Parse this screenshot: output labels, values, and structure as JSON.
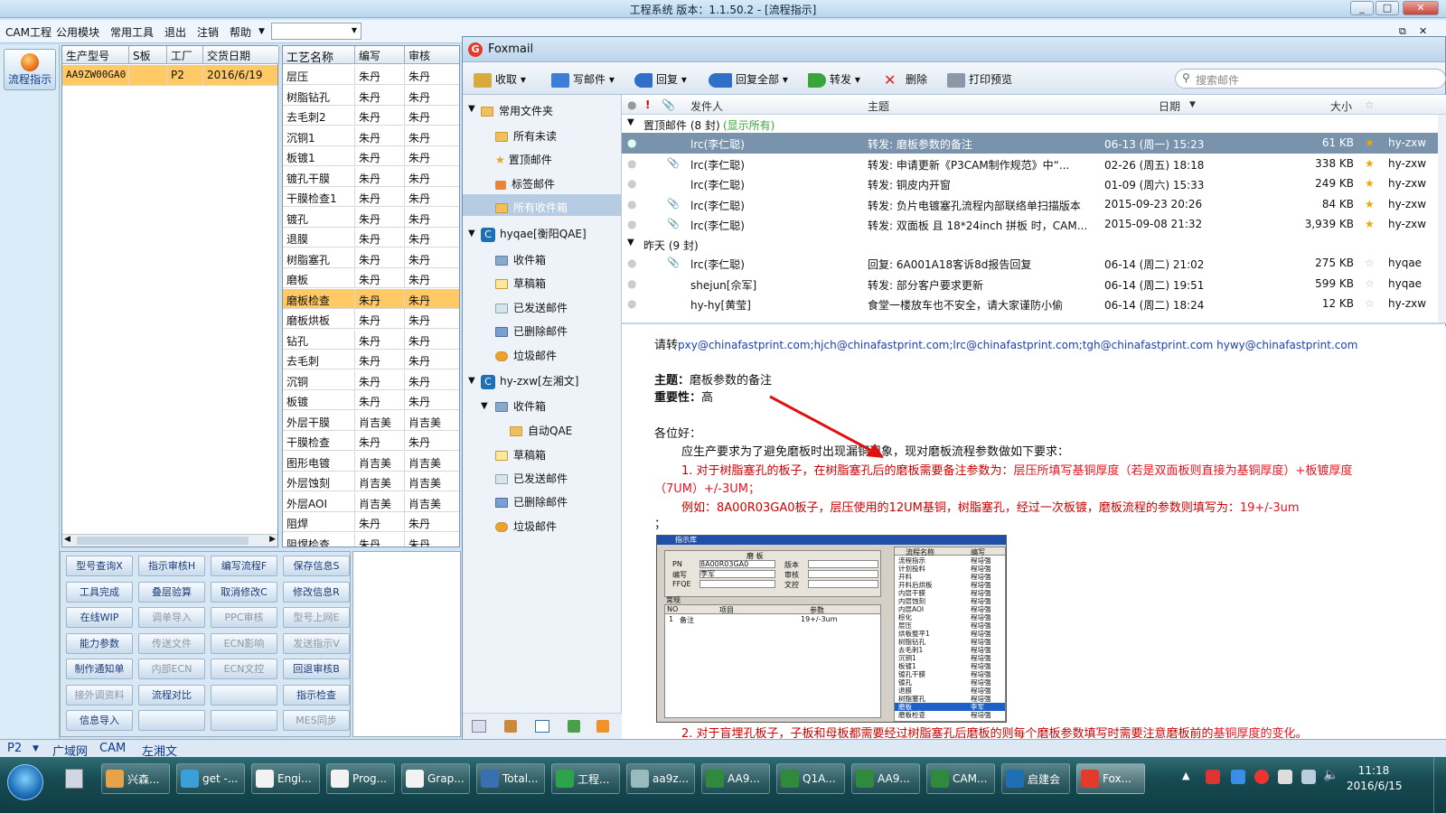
{
  "window": {
    "title": "工程系统   版本：1.1.50.2 - [流程指示]"
  },
  "menu": {
    "items": [
      "CAM工程",
      "公用模块",
      "常用工具",
      "退出",
      "注销",
      "帮助"
    ],
    "dropdown_value": ""
  },
  "left": {
    "flow_label": "流程指示"
  },
  "left_grid": {
    "headers": [
      "生产型号",
      "S板",
      "工厂",
      "交货日期"
    ],
    "rows": [
      [
        "AA9ZW00GA0",
        "",
        "P2",
        "2016/6/19"
      ]
    ]
  },
  "process_grid": {
    "headers": [
      "工艺名称",
      "编写",
      "审核"
    ],
    "selected_index": 11,
    "rows": [
      [
        "层压",
        "朱丹",
        "朱丹"
      ],
      [
        "树脂钻孔",
        "朱丹",
        "朱丹"
      ],
      [
        "去毛刺2",
        "朱丹",
        "朱丹"
      ],
      [
        "沉铜1",
        "朱丹",
        "朱丹"
      ],
      [
        "板镀1",
        "朱丹",
        "朱丹"
      ],
      [
        "镀孔干膜",
        "朱丹",
        "朱丹"
      ],
      [
        "干膜检查1",
        "朱丹",
        "朱丹"
      ],
      [
        "镀孔",
        "朱丹",
        "朱丹"
      ],
      [
        "退膜",
        "朱丹",
        "朱丹"
      ],
      [
        "树脂塞孔",
        "朱丹",
        "朱丹"
      ],
      [
        "磨板",
        "朱丹",
        "朱丹"
      ],
      [
        "磨板检查",
        "朱丹",
        "朱丹"
      ],
      [
        "磨板烘板",
        "朱丹",
        "朱丹"
      ],
      [
        "钻孔",
        "朱丹",
        "朱丹"
      ],
      [
        "去毛刺",
        "朱丹",
        "朱丹"
      ],
      [
        "沉铜",
        "朱丹",
        "朱丹"
      ],
      [
        "板镀",
        "朱丹",
        "朱丹"
      ],
      [
        "外层干膜",
        "肖吉美",
        "肖吉美"
      ],
      [
        "干膜检查",
        "朱丹",
        "朱丹"
      ],
      [
        "图形电镀",
        "肖吉美",
        "肖吉美"
      ],
      [
        "外层蚀刻",
        "肖吉美",
        "肖吉美"
      ],
      [
        "外层AOI",
        "肖吉美",
        "肖吉美"
      ],
      [
        "阻焊",
        "朱丹",
        "朱丹"
      ],
      [
        "阻焊检查",
        "朱丹",
        "朱丹"
      ]
    ]
  },
  "func_buttons": [
    {
      "label": "型号查询X",
      "enabled": true
    },
    {
      "label": "指示审核H",
      "enabled": true
    },
    {
      "label": "编写流程F",
      "enabled": true
    },
    {
      "label": "保存信息S",
      "enabled": true
    },
    {
      "label": "工具完成",
      "enabled": true
    },
    {
      "label": "叠层验算",
      "enabled": true
    },
    {
      "label": "取消修改C",
      "enabled": true
    },
    {
      "label": "修改信息R",
      "enabled": true
    },
    {
      "label": "在线WIP",
      "enabled": true
    },
    {
      "label": "调单导入",
      "enabled": false
    },
    {
      "label": "PPC审核",
      "enabled": false
    },
    {
      "label": "型号上网E",
      "enabled": false
    },
    {
      "label": "能力参数",
      "enabled": true
    },
    {
      "label": "传送文件",
      "enabled": false
    },
    {
      "label": "ECN影响",
      "enabled": false
    },
    {
      "label": "发送指示V",
      "enabled": false
    },
    {
      "label": "制作通知单",
      "enabled": true
    },
    {
      "label": "内部ECN",
      "enabled": false
    },
    {
      "label": "ECN文控",
      "enabled": false
    },
    {
      "label": "回退审核B",
      "enabled": true
    },
    {
      "label": "接外调资料",
      "enabled": false
    },
    {
      "label": "流程对比",
      "enabled": true
    },
    {
      "label": "",
      "enabled": true
    },
    {
      "label": "指示检查",
      "enabled": true
    },
    {
      "label": "信息导入",
      "enabled": true
    },
    {
      "label": "",
      "enabled": true
    },
    {
      "label": "",
      "enabled": true
    },
    {
      "label": "MES同步",
      "enabled": false
    }
  ],
  "statusbar": {
    "factory": "P2",
    "items": [
      "广域网",
      "CAM",
      "左湘文"
    ]
  },
  "foxmail": {
    "title": "Foxmail",
    "toolbar": [
      "收取",
      "写邮件",
      "回复",
      "回复全部",
      "转发",
      "删除",
      "打印预览"
    ],
    "search_placeholder": "搜索邮件",
    "nav": {
      "common_header": "常用文件夹",
      "common": [
        "所有未读",
        "置顶邮件",
        "标签邮件",
        "所有收件箱"
      ],
      "account1": "hyqae[衡阳QAE]",
      "account1_folders": [
        "收件箱",
        "草稿箱",
        "已发送邮件",
        "已删除邮件",
        "垃圾邮件"
      ],
      "account2": "hy-zxw[左湘文]",
      "account2_inbox": "收件箱",
      "account2_sub": "自动QAE",
      "account2_folders": [
        "草稿箱",
        "已发送邮件",
        "已删除邮件",
        "垃圾邮件"
      ]
    },
    "list_headers": {
      "sender": "发件人",
      "subject": "主题",
      "date": "日期",
      "size": "大小"
    },
    "group_pinned": "置顶邮件 (8 封)",
    "group_pinned_link": "(显示所有)",
    "group_yesterday": "昨天 (9 封)",
    "pinned": [
      {
        "sender": "lrc(李仁聪)",
        "subject": "转发: 磨板参数的备注",
        "date": "06-13 (周一) 15:23",
        "size": "61 KB",
        "account": "hy-zxw",
        "attach": false
      },
      {
        "sender": "lrc(李仁聪)",
        "subject": "转发: 申请更新《P3CAM制作规范》中“...",
        "date": "02-26 (周五) 18:18",
        "size": "338 KB",
        "account": "hy-zxw",
        "attach": true
      },
      {
        "sender": "lrc(李仁聪)",
        "subject": "转发: 铜皮内开窗",
        "date": "01-09 (周六) 15:33",
        "size": "249 KB",
        "account": "hy-zxw",
        "attach": false
      },
      {
        "sender": "lrc(李仁聪)",
        "subject": "转发: 负片电镀塞孔流程内部联络单扫描版本",
        "date": "2015-09-23 20:26",
        "size": "84 KB",
        "account": "hy-zxw",
        "attach": true
      },
      {
        "sender": "lrc(李仁聪)",
        "subject": "转发: 双面板 且 18*24inch 拼板 时，CAM...",
        "date": "2015-09-08 21:32",
        "size": "3,939 KB",
        "account": "hy-zxw",
        "attach": true
      }
    ],
    "yesterday": [
      {
        "sender": "lrc(李仁聪)",
        "subject": "回复: 6A001A18客诉8d报告回复",
        "date": "06-14 (周二) 21:02",
        "size": "275 KB",
        "account": "hyqae",
        "attach": true
      },
      {
        "sender": "shejun[佘军]",
        "subject": "转发: 部分客户要求更新",
        "date": "06-14 (周二) 19:51",
        "size": "599 KB",
        "account": "hyqae",
        "attach": false
      },
      {
        "sender": "hy-hy[黄莹]",
        "subject": "食堂一楼放车也不安全，请大家谨防小偷",
        "date": "06-14 (周二) 18:24",
        "size": "12 KB",
        "account": "hy-zxw",
        "attach": false
      }
    ],
    "reading": {
      "forward_prefix": "请转",
      "forward_emails": "pxy@chinafastprint.com;hjch@chinafastprint.com;lrc@chinafastprint.com;tgh@chinafastprint.com hywy@chinafastprint.com",
      "subject_label": "主题：",
      "subject": "磨板参数的备注",
      "importance_label": "重要性：",
      "importance": "高",
      "greeting": "各位好：",
      "intro": "应生产要求为了避免磨板时出现漏铜现象，现对磨板流程参数做如下要求：",
      "item1_prefix": "1.   对于树脂塞孔的板子，在树脂塞孔后的磨板需要备注参数为：",
      "item1_red": "层压所填写基铜厚度（若是双面板则直接为基铜厚度）+板镀厚度",
      "item1_red2": "（7UM）+/-3UM；",
      "example_prefix": "例如：",
      "example_blue": "8A00R03GA0",
      "example_mid": "板子，层压使用的",
      "example_blue2": "12UM",
      "example_mid2": "基铜，树脂塞孔，经过一次板镀，磨板流程的参数则填写为：",
      "example_red": "19+/-3um",
      "semicolon": "；",
      "item2_prefix": "2.  对于盲埋孔板子，子板和母板都需要经过树脂塞孔后磨板的则每个磨板参数填写时需要注意磨板前的",
      "item2_red": "基铜厚度的变化",
      "item2_suffix": "。",
      "shot": {
        "title": "指示库",
        "panel": "磨 板",
        "pn_label": "PN",
        "pn_value": "8A00R03GA0",
        "version_label": "版本",
        "writer_label": "编写",
        "writer_value": "李军",
        "review_label": "审核",
        "ffqe_label": "FFQE",
        "doc_label": "文控",
        "tab": "常规",
        "cols": [
          "NO",
          "项目",
          "参数"
        ],
        "row": [
          "1",
          "备注",
          "19+/-3um"
        ],
        "flow_header": [
          "流程名称",
          "编写"
        ],
        "flows": [
          "流程指示",
          "计划投料",
          "开料",
          "开料后烘板",
          "内层干膜",
          "内层蚀刻",
          "内层AOI",
          "棕化",
          "层压",
          "烘板整平1",
          "树脂钻孔",
          "去毛刺1",
          "沉铜1",
          "板镀1",
          "镀孔干膜",
          "镀孔",
          "退膜",
          "树脂塞孔",
          "磨板",
          "磨板检查"
        ],
        "flow_writer": "程培强",
        "flow_selected_writer": "李军"
      }
    }
  },
  "taskbar": {
    "items": [
      "兴森...",
      "get -...",
      "Engi...",
      "Prog...",
      "Grap...",
      "Total...",
      "工程...",
      "aa9z...",
      "AA9...",
      "Q1A...",
      "AA9...",
      "CAM...",
      "启建会",
      "Fox..."
    ],
    "time": "11:18",
    "date": "2016/6/15"
  }
}
